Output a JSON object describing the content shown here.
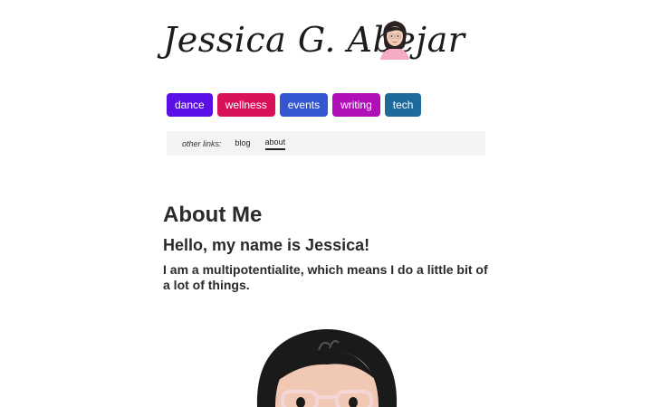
{
  "header": {
    "site_title": "Jessica G. Abejar"
  },
  "categories": [
    {
      "label": "dance",
      "color": "#5a0fe6"
    },
    {
      "label": "wellness",
      "color": "#d9115a"
    },
    {
      "label": "events",
      "color": "#3456d0"
    },
    {
      "label": "writing",
      "color": "#b00fb8"
    },
    {
      "label": "tech",
      "color": "#1e6a9c"
    }
  ],
  "other_links": {
    "label": "other links:",
    "links": [
      {
        "label": "blog",
        "active": false
      },
      {
        "label": "about",
        "active": true
      }
    ]
  },
  "main": {
    "title": "About Me",
    "greeting": "Hello, my name is Jessica!",
    "intro": "I am a multipotentialite, which means I do a little bit of a lot of things."
  },
  "icons": {
    "header_avatar": "avatar-icon",
    "portrait": "portrait-illustration"
  }
}
